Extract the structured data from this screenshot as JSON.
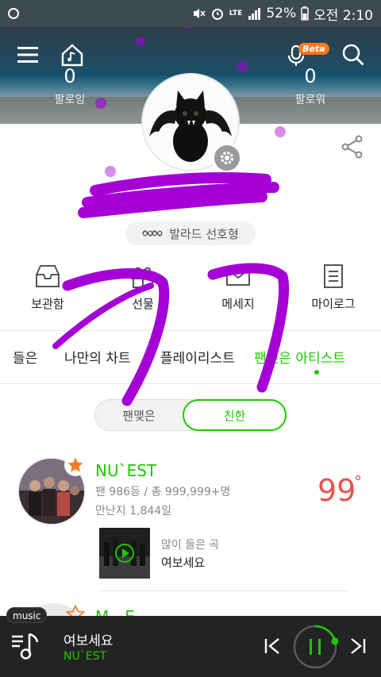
{
  "status_bar": {
    "battery": "52%",
    "time": "오전 2:10",
    "network": "LTE"
  },
  "header": {
    "following_count": "0",
    "following_label": "팔로잉",
    "follower_count": "0",
    "follower_label": "팔로워",
    "beta_label": "Beta"
  },
  "profile": {
    "genre_label": "발라드 선호형"
  },
  "menu": {
    "items": [
      {
        "label": "보관함",
        "icon": "inbox-icon"
      },
      {
        "label": "선물",
        "icon": "gift-icon"
      },
      {
        "label": "메세지",
        "icon": "message-icon"
      },
      {
        "label": "마이로그",
        "icon": "document-icon"
      }
    ]
  },
  "tabs": {
    "items": [
      "들은",
      "나만의 차트",
      "플레이리스트",
      "팬맺은 아티스트"
    ],
    "active": "팬맺은 아티스트"
  },
  "toggle": {
    "option_off": "팬맺은",
    "option_on": "친한"
  },
  "artist": {
    "name": "NU`EST",
    "fan_rank": "팬 986등 / 총 999,999+명",
    "days": "만난지 1,844일",
    "score": "99",
    "degree": "°",
    "top_song_label": "많이 들은 곡",
    "top_song_title": "여보세요",
    "next_name_partial": "M…E…"
  },
  "player": {
    "tag": "music",
    "title": "여보세요",
    "artist": "NU`EST",
    "accent": "#1ec800"
  },
  "colors": {
    "brand_green": "#1ec800",
    "score_red": "#e8534d",
    "scribble_purple": "#a400d6"
  }
}
